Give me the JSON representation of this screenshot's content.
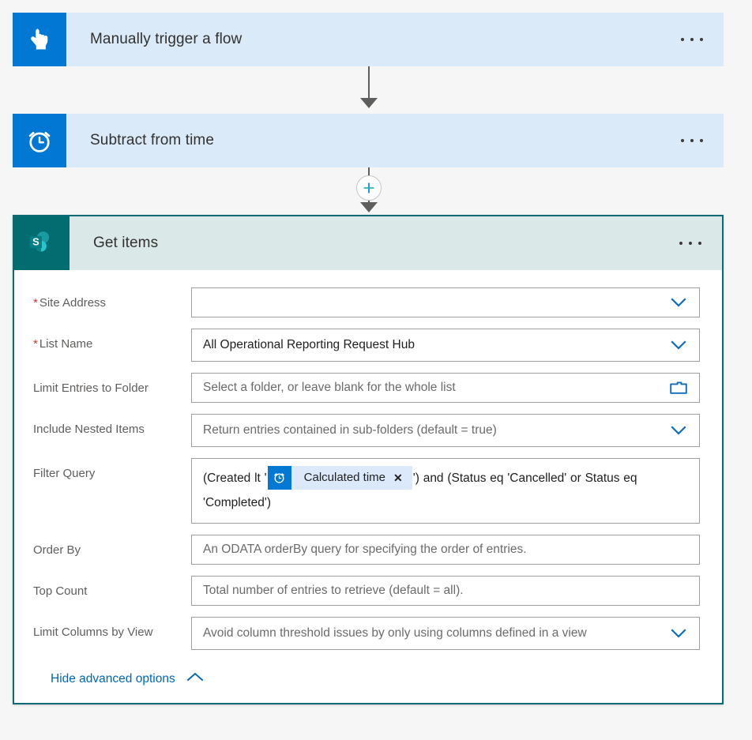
{
  "flow": {
    "nodes": [
      {
        "id": "trigger",
        "title": "Manually trigger a flow",
        "icon": "tap-finger-icon",
        "menu": "more-options"
      },
      {
        "id": "subtract-from-time",
        "title": "Subtract from time",
        "icon": "alarm-clock-icon",
        "menu": "more-options"
      },
      {
        "id": "get-items",
        "title": "Get items",
        "icon": "sharepoint-icon",
        "menu": "more-options"
      }
    ],
    "insert_step_label": "+"
  },
  "get_items": {
    "fields": [
      {
        "label": "Site Address",
        "required": true,
        "value": "",
        "placeholder": "",
        "affordance": "chevron-down-icon"
      },
      {
        "label": "List Name",
        "required": true,
        "value": "All Operational Reporting Request Hub",
        "placeholder": "",
        "affordance": "chevron-down-icon"
      },
      {
        "label": "Limit Entries to Folder",
        "required": false,
        "value": "",
        "placeholder": "Select a folder, or leave blank for the whole list",
        "affordance": "folder-icon"
      },
      {
        "label": "Include Nested Items",
        "required": false,
        "value": "",
        "placeholder": "Return entries contained in sub-folders (default = true)",
        "affordance": "chevron-down-icon"
      },
      {
        "label": "Order By",
        "required": false,
        "value": "",
        "placeholder": "An ODATA orderBy query for specifying the order of entries.",
        "affordance": "none"
      },
      {
        "label": "Top Count",
        "required": false,
        "value": "",
        "placeholder": "Total number of entries to retrieve (default = all).",
        "affordance": "none"
      },
      {
        "label": "Limit Columns by View",
        "required": false,
        "value": "",
        "placeholder": "Avoid column threshold issues by only using columns defined in a view",
        "affordance": "chevron-down-icon"
      }
    ],
    "filter_query": {
      "label": "Filter Query",
      "required": false,
      "text_before": "(Created lt '",
      "token": {
        "label": "Calculated time",
        "icon": "alarm-clock-icon",
        "remove": "✕"
      },
      "text_after": "') and (Status eq 'Cancelled' or Status eq 'Completed')"
    },
    "advanced_toggle": {
      "label": "Hide advanced options",
      "icon": "chevron-up-icon"
    }
  },
  "colors": {
    "trigger_header": "#daeaf9",
    "trigger_icon": "#0078d4",
    "sharepoint_header": "#dae8e8",
    "sharepoint_icon": "#036c70",
    "selected_border": "#0b6a73",
    "link": "#0067b8",
    "required_asterisk": "#d13438",
    "token_background": "#dbe9fb",
    "token_icon": "#0078d4"
  }
}
